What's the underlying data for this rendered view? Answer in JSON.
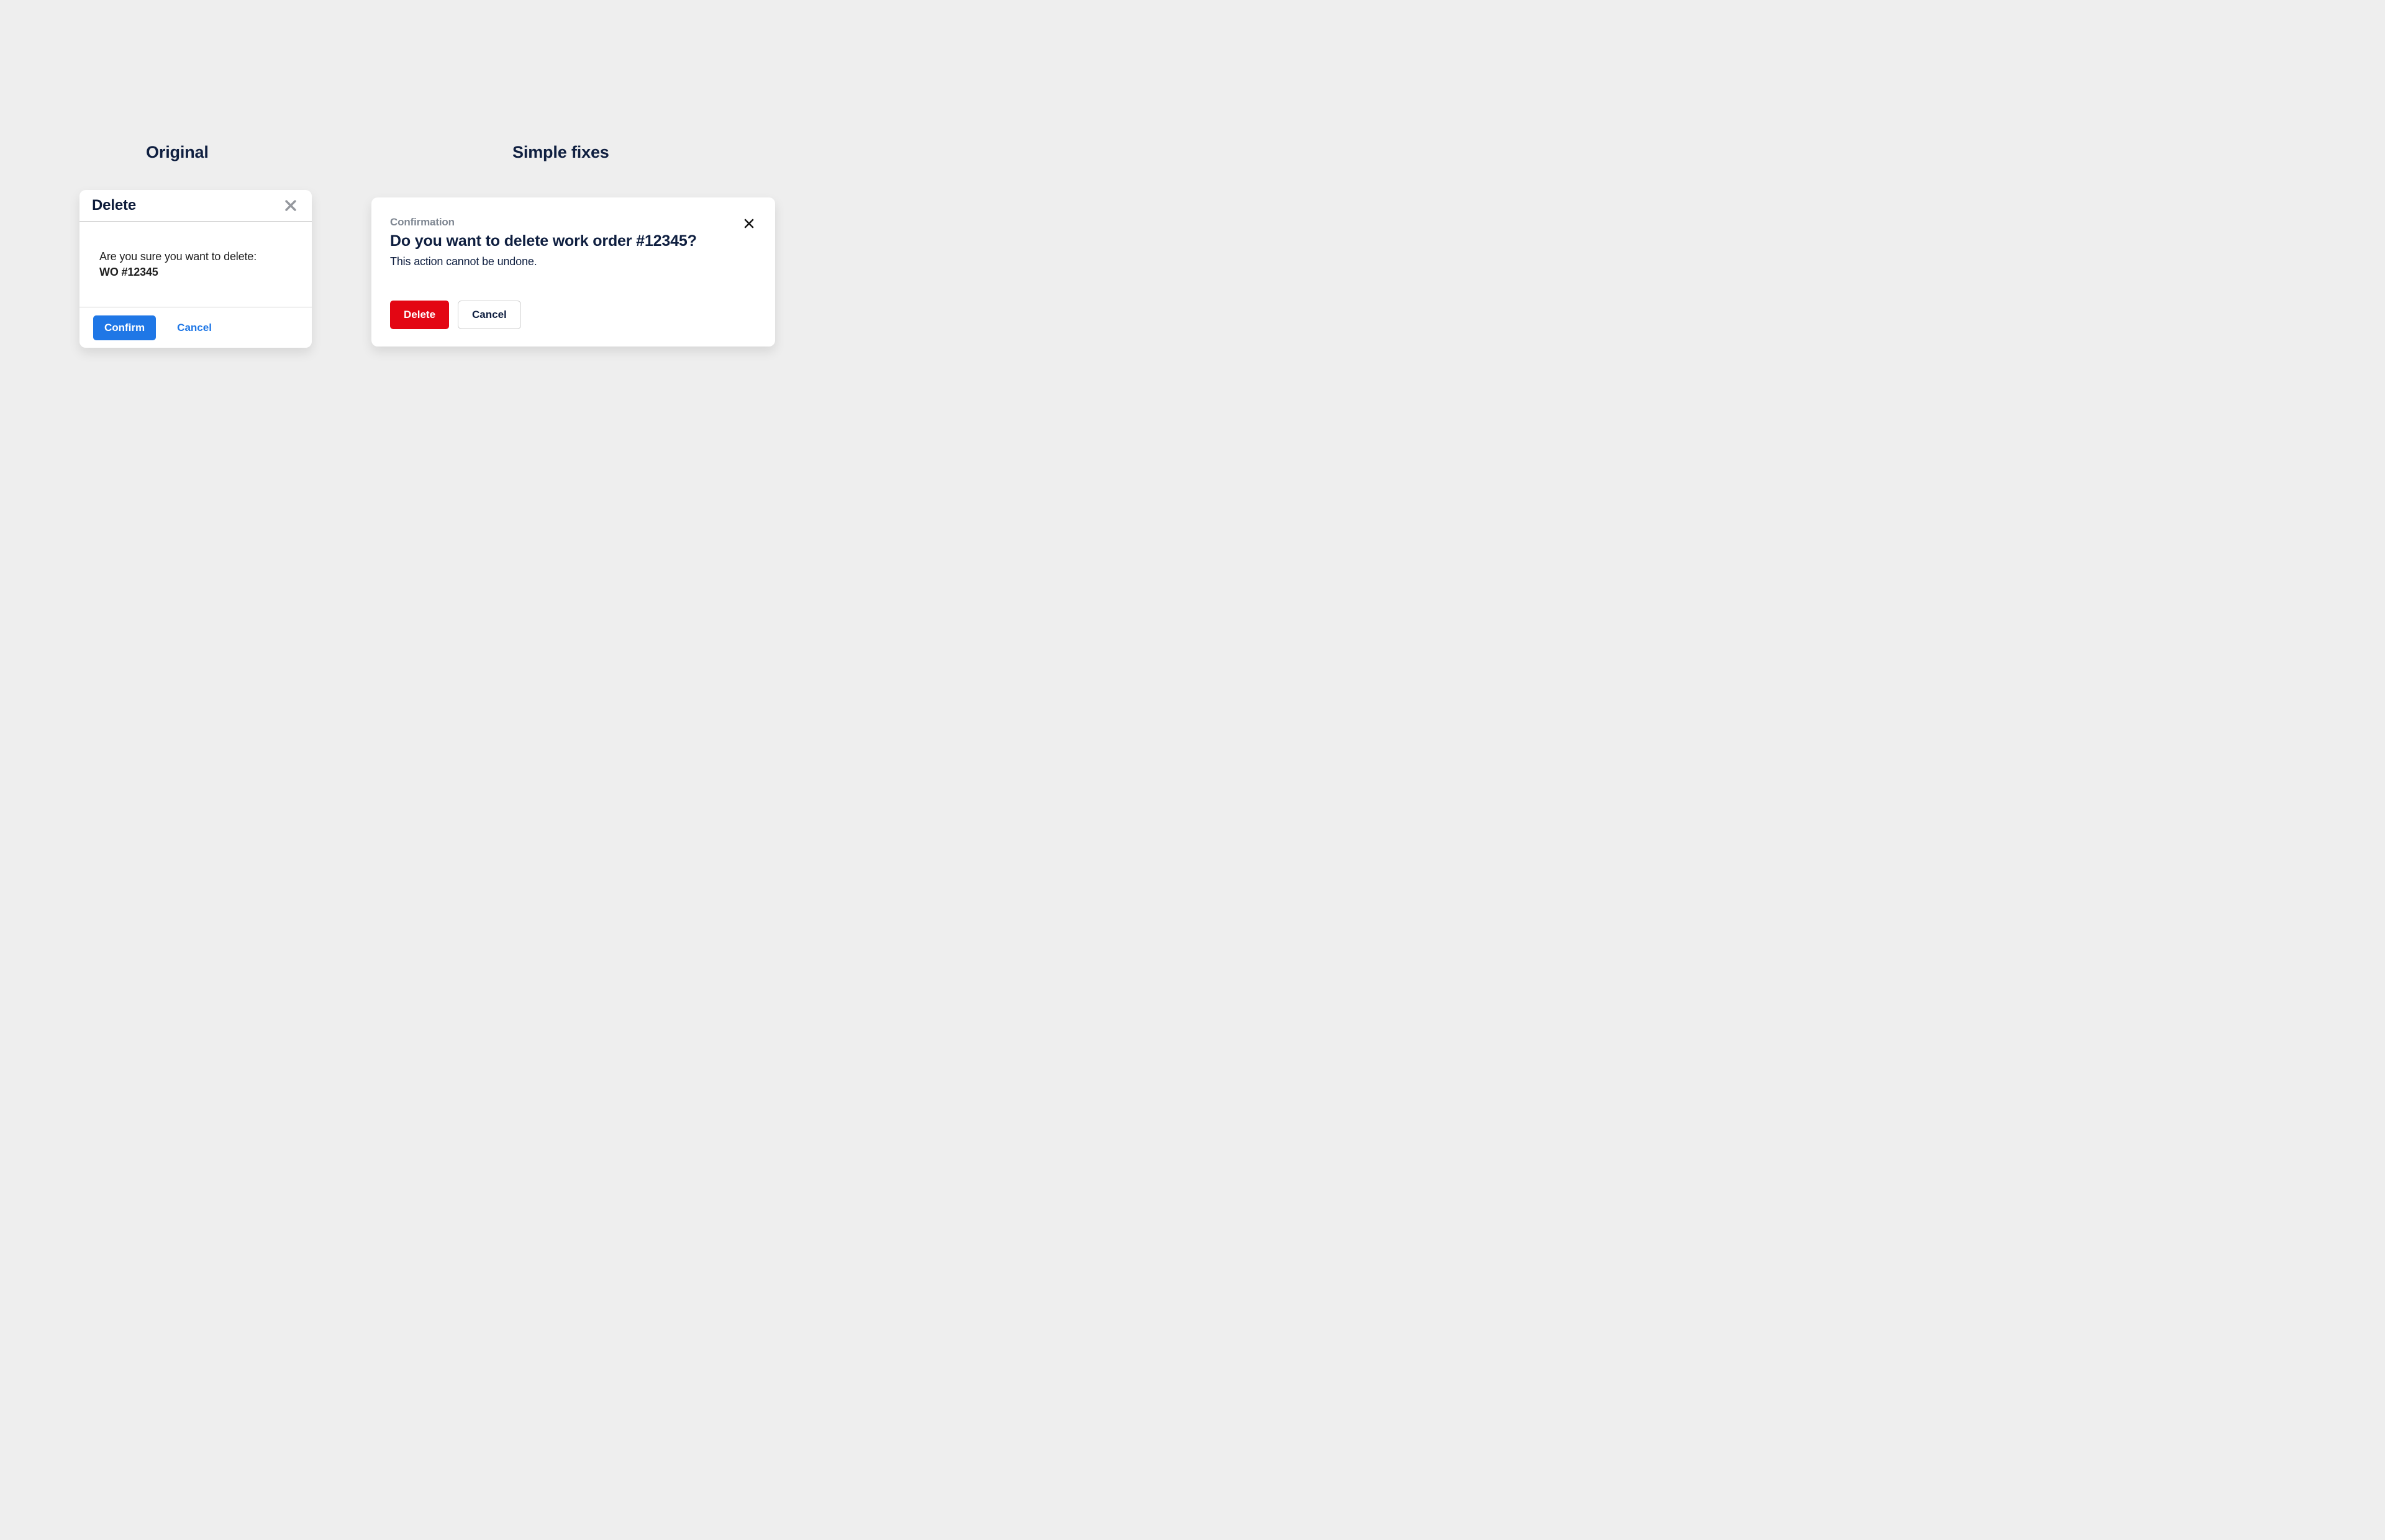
{
  "headings": {
    "left": "Original",
    "right": "Simple fixes"
  },
  "dialog_a": {
    "title": "Delete",
    "prompt": "Are you sure you want to delete:",
    "item": "WO #12345",
    "confirm_label": "Confirm",
    "cancel_label": "Cancel"
  },
  "dialog_b": {
    "eyebrow": "Confirmation",
    "title": "Do you want to delete work order #12345?",
    "subtitle": "This action cannot be undone.",
    "delete_label": "Delete",
    "cancel_label": "Cancel"
  }
}
